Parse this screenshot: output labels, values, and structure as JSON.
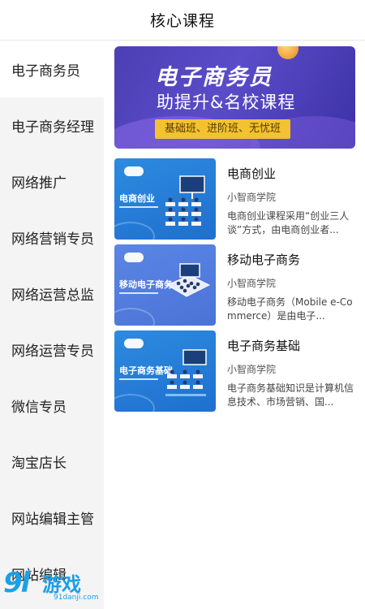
{
  "header": {
    "title": "核心课程"
  },
  "sidebar": {
    "items": [
      {
        "label": "电子商务员",
        "active": true
      },
      {
        "label": "电子商务经理"
      },
      {
        "label": "网络推广"
      },
      {
        "label": "网络营销专员"
      },
      {
        "label": "网络运营总监"
      },
      {
        "label": "网络运营专员"
      },
      {
        "label": "微信专员"
      },
      {
        "label": "淘宝店长"
      },
      {
        "label": "网站编辑主管"
      },
      {
        "label": "网站编辑"
      }
    ]
  },
  "banner": {
    "title": "电子商务员",
    "subtitle": "助提升&名校课程",
    "tag": "基础班、进阶班、无忧班"
  },
  "courses": [
    {
      "thumb_label": "电商创业",
      "title": "电商创业",
      "school": "小智商学院",
      "desc": "电商创业课程采用“创业三人谈”方式，由电商创业者..."
    },
    {
      "thumb_label": "移动电子商务",
      "title": "移动电子商务",
      "school": "小智商学院",
      "desc": "移动电子商务（Mobile e-Commerce）是由电子..."
    },
    {
      "thumb_label": "电子商务基础",
      "title": "电子商务基础",
      "school": "小智商学院",
      "desc": "电子商务基础知识是计算机信息技术、市场营销、国..."
    }
  ],
  "watermark": {
    "logo": "9l",
    "text": "游戏",
    "url": "91danji.com"
  },
  "colors": {
    "accent_blue": "#2d8be0",
    "banner_purple": "#4c3fb4",
    "tag_yellow": "#f2c230"
  }
}
